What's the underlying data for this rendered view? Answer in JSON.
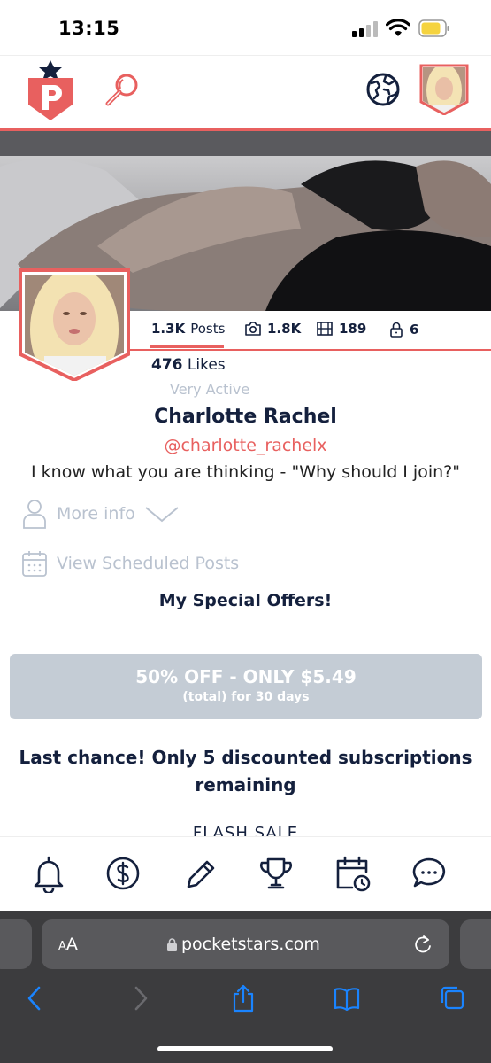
{
  "status_bar": {
    "time": "13:15",
    "battery_color": "#f5d33f"
  },
  "header": {
    "accent": "#e8605f",
    "navy": "#14203d"
  },
  "profile": {
    "posts_count": "1.3K",
    "posts_label": "Posts",
    "photos_count": "1.8K",
    "videos_count": "189",
    "locked_count": "6",
    "likes_count": "476",
    "likes_label": "Likes",
    "activity": "Very Active",
    "name": "Charlotte Rachel",
    "handle": "@charlotte_rachelx",
    "bio": "I know what you are thinking - \"Why should I join?\"",
    "more_info": "More info",
    "scheduled": "View Scheduled Posts"
  },
  "offers": {
    "title": "My Special Offers!",
    "main": "50% OFF - ONLY $5.49",
    "sub": "(total) for 30 days",
    "last_chance": "Last chance! Only 5 discounted subscriptions remaining",
    "flash": "FLASH SALE"
  },
  "bottom_nav": [
    "bell-icon",
    "dollar-icon",
    "pencil-icon",
    "trophy-icon",
    "calendar-clock-icon",
    "chat-icon"
  ],
  "browser": {
    "aa_small": "A",
    "aa_big": "A",
    "url": "pocketstars.com",
    "accent": "#1a84ff"
  }
}
